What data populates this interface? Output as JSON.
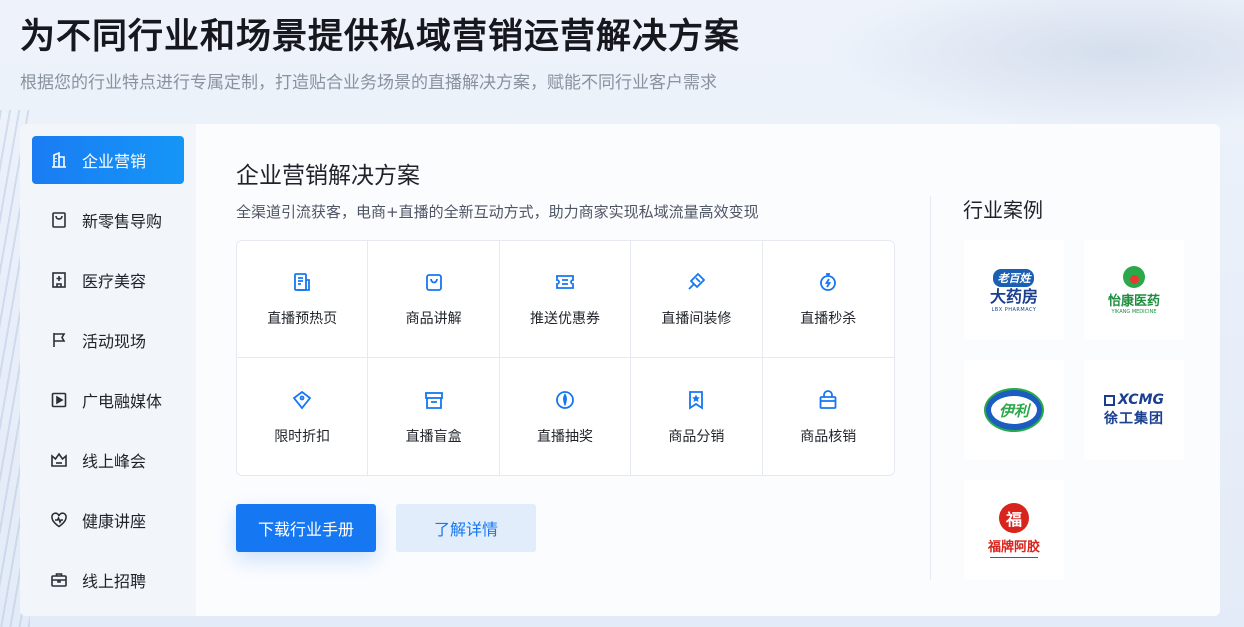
{
  "header": {
    "title": "为不同行业和场景提供私域营销运营解决方案",
    "subtitle": "根据您的行业特点进行专属定制，打造贴合业务场景的直播解决方案，赋能不同行业客户需求"
  },
  "sidebar": {
    "items": [
      {
        "label": "企业营销",
        "icon": "building-icon",
        "active": true
      },
      {
        "label": "新零售导购",
        "icon": "shopping-bag-icon",
        "active": false
      },
      {
        "label": "医疗美容",
        "icon": "hospital-icon",
        "active": false
      },
      {
        "label": "活动现场",
        "icon": "flag-icon",
        "active": false
      },
      {
        "label": "广电融媒体",
        "icon": "play-icon",
        "active": false
      },
      {
        "label": "线上峰会",
        "icon": "crown-icon",
        "active": false
      },
      {
        "label": "健康讲座",
        "icon": "heart-icon",
        "active": false
      },
      {
        "label": "线上招聘",
        "icon": "briefcase-icon",
        "active": false
      }
    ]
  },
  "main": {
    "title": "企业营销解决方案",
    "description": "全渠道引流获客，电商+直播的全新互动方式，助力商家实现私域流量高效变现",
    "features": [
      {
        "label": "直播预热页",
        "icon": "document-icon"
      },
      {
        "label": "商品讲解",
        "icon": "shopping-bag-icon"
      },
      {
        "label": "推送优惠券",
        "icon": "coupon-icon"
      },
      {
        "label": "直播间装修",
        "icon": "paint-brush-icon"
      },
      {
        "label": "直播秒杀",
        "icon": "stopwatch-icon"
      },
      {
        "label": "限时折扣",
        "icon": "tag-icon"
      },
      {
        "label": "直播盲盒",
        "icon": "box-icon"
      },
      {
        "label": "直播抽奖",
        "icon": "lottery-icon"
      },
      {
        "label": "商品分销",
        "icon": "bookmark-star-icon"
      },
      {
        "label": "商品核销",
        "icon": "lock-bag-icon"
      }
    ],
    "buttons": {
      "download": "下载行业手册",
      "details": "了解详情"
    }
  },
  "cases": {
    "title": "行业案例",
    "logos": [
      {
        "name": "laobaixing-logo",
        "text_top": "老百姓",
        "text_main": "大药房",
        "text_sub": "LBX PHARMACY"
      },
      {
        "name": "yikang-logo",
        "text_main": "怡康医药",
        "text_sub": "YIKANG MEDICINE"
      },
      {
        "name": "yili-logo",
        "text_main": "伊利"
      },
      {
        "name": "xcmg-logo",
        "text_top": "XCMG",
        "text_main": "徐工集团"
      },
      {
        "name": "fupai-logo",
        "text_top": "福",
        "text_main": "福牌阿胶"
      }
    ]
  },
  "colors": {
    "accent": "#1677f2",
    "accent_light": "#e1edfb",
    "text_primary": "#1f2329",
    "text_secondary": "#8a919f"
  }
}
